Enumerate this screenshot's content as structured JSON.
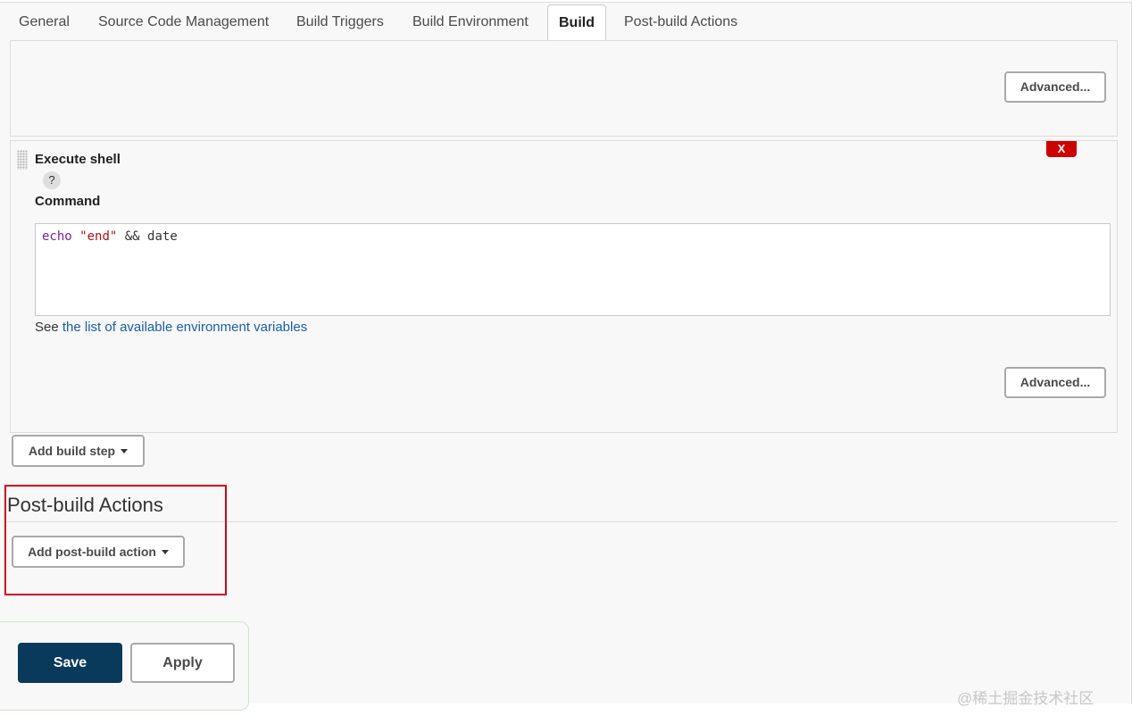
{
  "tabs": [
    {
      "label": "General"
    },
    {
      "label": "Source Code Management"
    },
    {
      "label": "Build Triggers"
    },
    {
      "label": "Build Environment"
    },
    {
      "label": "Build",
      "active": true
    },
    {
      "label": "Post-build Actions"
    }
  ],
  "previous_step": {
    "advanced_label": "Advanced..."
  },
  "execute_shell": {
    "title": "Execute shell",
    "delete_label": "X",
    "help_label": "?",
    "command_label": "Command",
    "command": {
      "keyword": "echo",
      "string": "\"end\"",
      "rest": "&& date"
    },
    "env_prefix": "See",
    "env_link": "the list of available environment variables",
    "advanced_label": "Advanced..."
  },
  "add_build_step_label": "Add build step",
  "post_build": {
    "title": "Post-build Actions",
    "add_label": "Add post-build action"
  },
  "footer": {
    "save_label": "Save",
    "apply_label": "Apply"
  },
  "watermark": "@稀土掘金技术社区",
  "colors": {
    "save_bg": "#093a5b",
    "delete_bg": "#cc0000",
    "highlight": "#d0021b",
    "link": "#1a5fa8"
  }
}
